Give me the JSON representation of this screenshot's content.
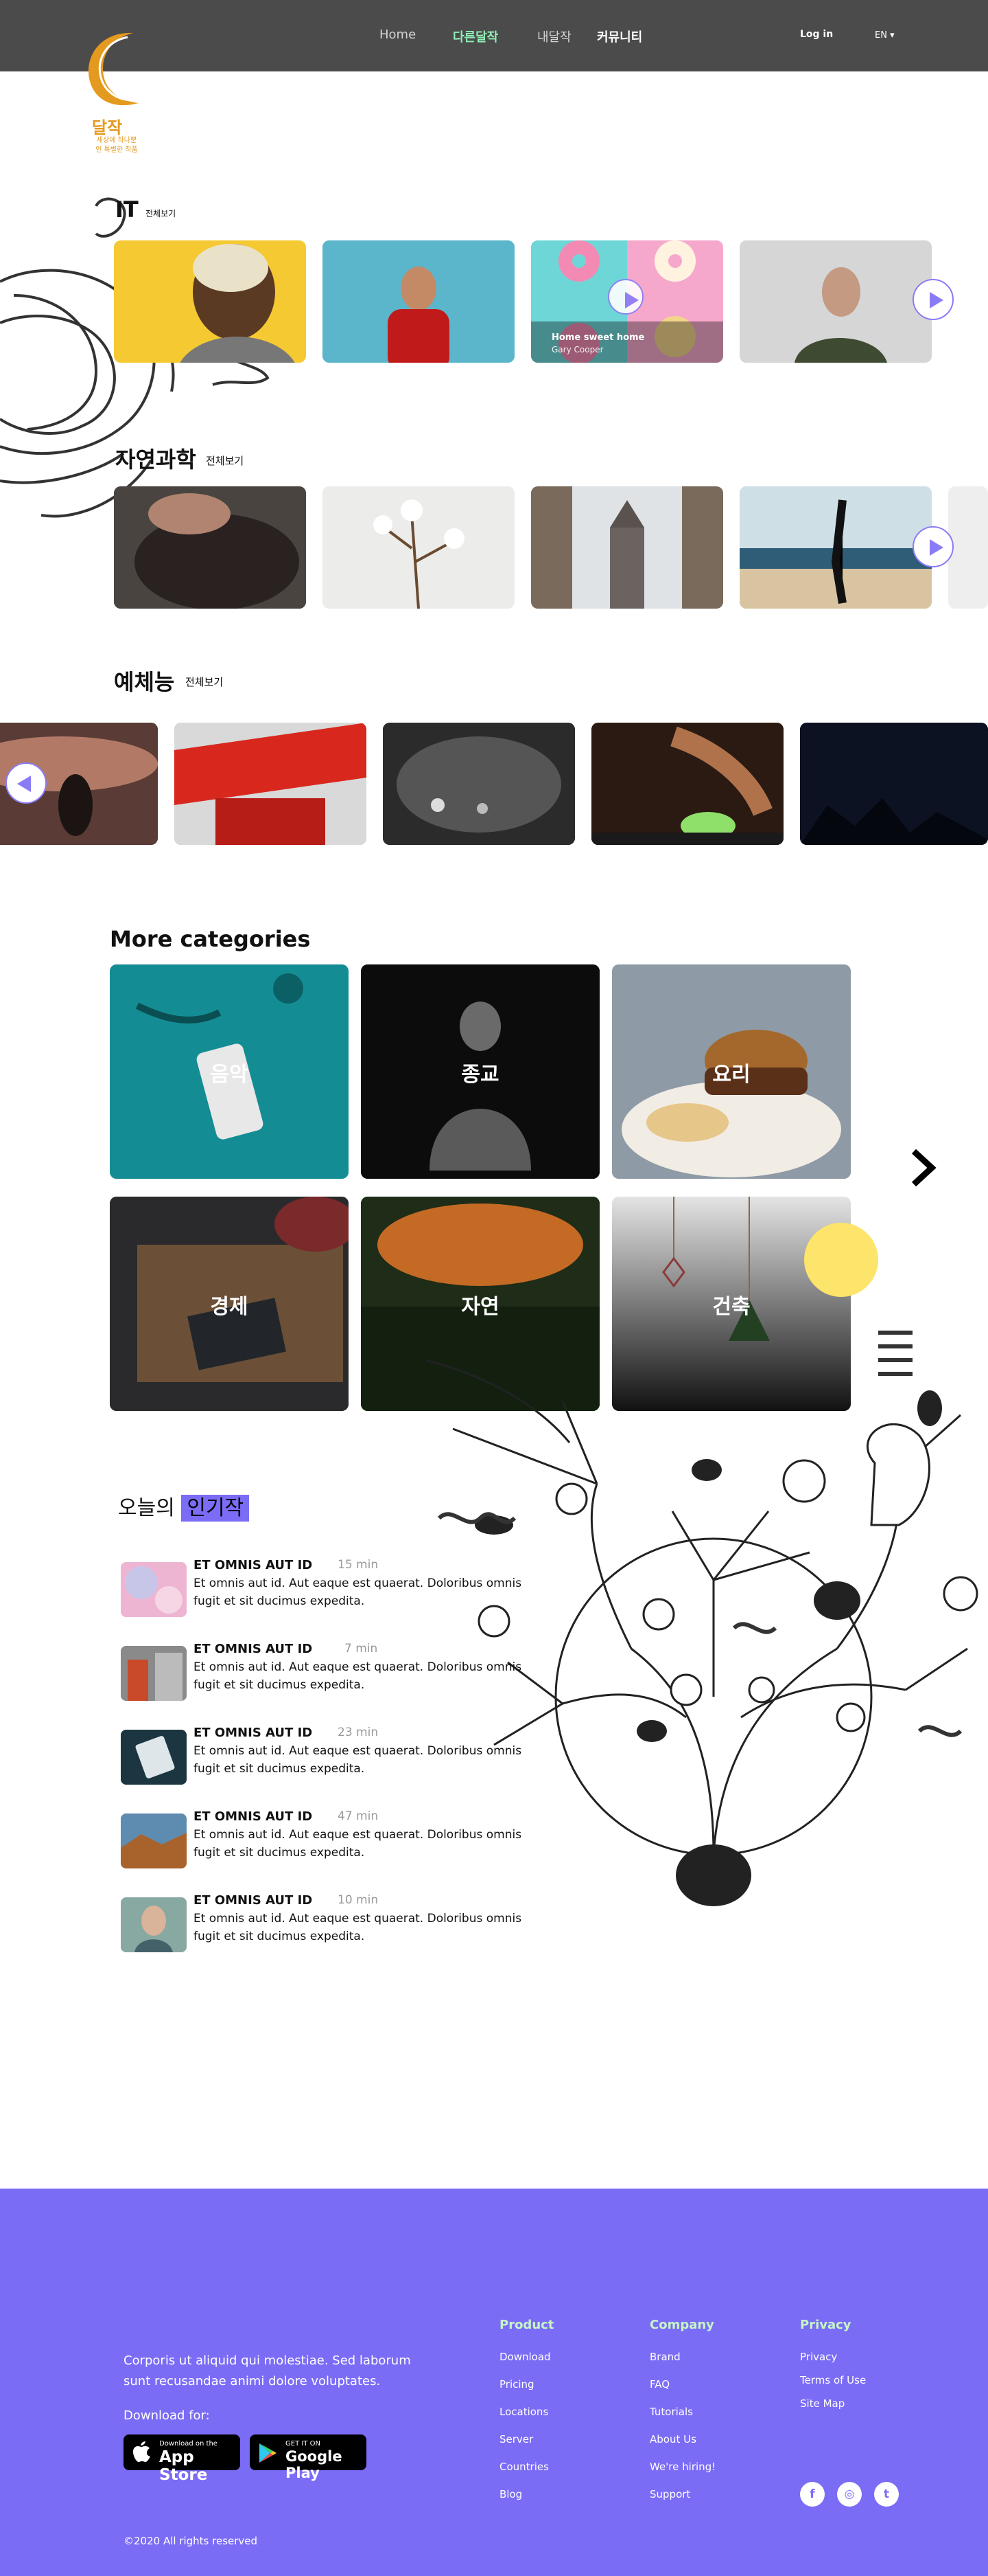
{
  "header": {
    "nav": [
      "Home",
      "다른달작",
      "내달작",
      "커뮤니티"
    ],
    "login": "Log in",
    "lang": "EN ▾",
    "logo_title": "달작",
    "logo_sub_1": "세상에 하나뿐",
    "logo_sub_2": "인 특별한 작품"
  },
  "sections": [
    {
      "title": "IT",
      "more": "전체보기",
      "cards": [
        {
          "caption": "",
          "sub": ""
        },
        {
          "caption": "",
          "sub": ""
        },
        {
          "caption": "Home sweet home",
          "sub": "Gary Cooper"
        },
        {
          "caption": "",
          "sub": ""
        }
      ]
    },
    {
      "title": "자연과학",
      "more": "전체보기"
    },
    {
      "title": "예체능",
      "more": "전체보기"
    }
  ],
  "more_categories": {
    "title": "More categories",
    "items": [
      "음악",
      "종교",
      "요리",
      "경제",
      "자연",
      "건축"
    ]
  },
  "popular": {
    "prefix": "오늘의",
    "highlight": "인기작",
    "items": [
      {
        "title": "ET OMNIS AUT ID",
        "time": "15 min",
        "desc": "Et omnis aut id. Aut eaque est quaerat. Doloribus omnis fugit et sit ducimus expedita."
      },
      {
        "title": "ET OMNIS AUT ID",
        "time": "7 min",
        "desc": "Et omnis aut id. Aut eaque est quaerat. Doloribus omnis fugit et sit ducimus expedita."
      },
      {
        "title": "ET OMNIS AUT ID",
        "time": "23 min",
        "desc": "Et omnis aut id. Aut eaque est quaerat. Doloribus omnis fugit et sit ducimus expedita."
      },
      {
        "title": "ET OMNIS AUT ID",
        "time": "47 min",
        "desc": "Et omnis aut id. Aut eaque est quaerat. Doloribus omnis fugit et sit ducimus expedita."
      },
      {
        "title": "ET OMNIS AUT ID",
        "time": "10 min",
        "desc": "Et omnis aut id. Aut eaque est quaerat. Doloribus omnis fugit et sit ducimus expedita."
      }
    ]
  },
  "footer": {
    "about": "Corporis ut aliquid qui molestiae. Sed laborum sunt recusandae animi dolore voluptates.",
    "download_for": "Download for:",
    "appstore_small": "Download on the",
    "appstore_big": "App Store",
    "gplay_small": "GET IT ON",
    "gplay_big": "Google Play",
    "columns": [
      {
        "heading": "Product",
        "links": [
          "Download",
          "Pricing",
          "Locations",
          "Server",
          "Countries",
          "Blog"
        ]
      },
      {
        "heading": "Company",
        "links": [
          "Brand",
          "FAQ",
          "Tutorials",
          "About Us",
          "We're hiring!",
          "Support"
        ]
      },
      {
        "heading": "Privacy",
        "links": [
          "Privacy",
          "Terms of Use",
          "Site Map"
        ]
      }
    ],
    "social": [
      "f",
      "◎",
      "t"
    ],
    "copyright": "©2020 All rights reserved"
  },
  "colors": {
    "header": "#4b4b4b",
    "accent": "#7b6cf6",
    "brand": "#e49a1e",
    "nav_active": "#8ef0b4"
  }
}
